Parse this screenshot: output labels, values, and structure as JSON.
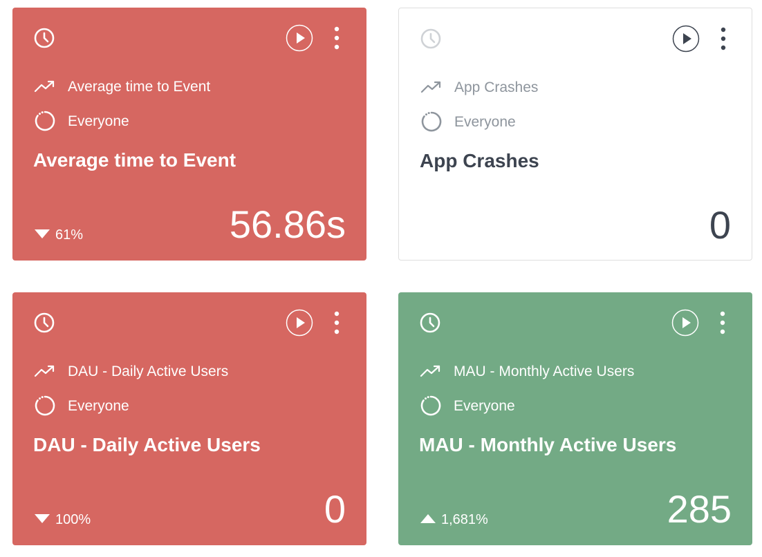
{
  "cards": [
    {
      "status": "negative",
      "status_color": "#d66761",
      "metric_name": "Average time to Event",
      "segment": "Everyone",
      "title": "Average time to Event",
      "change": "61%",
      "change_direction": "down",
      "value": "56.86s",
      "icons": [
        "clock-icon",
        "play-icon",
        "more-vertical-icon",
        "trend-icon",
        "segment-icon"
      ]
    },
    {
      "status": "neutral",
      "status_color": "#ffffff",
      "metric_name": "App Crashes",
      "segment": "Everyone",
      "title": "App Crashes",
      "change": "",
      "change_direction": "",
      "value": "0",
      "icons": [
        "clock-icon",
        "play-icon",
        "more-vertical-icon",
        "trend-icon",
        "segment-icon"
      ]
    },
    {
      "status": "negative",
      "status_color": "#d66761",
      "metric_name": "DAU - Daily Active Users",
      "segment": "Everyone",
      "title": "DAU - Daily Active Users",
      "change": "100%",
      "change_direction": "down",
      "value": "0",
      "icons": [
        "clock-icon",
        "play-icon",
        "more-vertical-icon",
        "trend-icon",
        "segment-icon"
      ]
    },
    {
      "status": "positive",
      "status_color": "#73aa85",
      "metric_name": "MAU - Monthly Active Users",
      "segment": "Everyone",
      "title": "MAU - Monthly Active Users",
      "change": "1,681%",
      "change_direction": "up",
      "value": "285",
      "icons": [
        "clock-icon",
        "play-icon",
        "more-vertical-icon",
        "trend-icon",
        "segment-icon"
      ]
    }
  ]
}
